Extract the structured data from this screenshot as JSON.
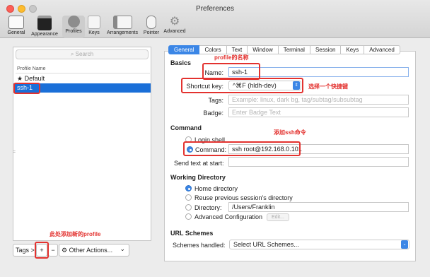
{
  "window": {
    "title": "Preferences"
  },
  "toolbar": [
    {
      "label": "General",
      "icon": "general-icon"
    },
    {
      "label": "Appearance",
      "icon": "appearance-icon"
    },
    {
      "label": "Profiles",
      "icon": "profiles-icon",
      "selected": true
    },
    {
      "label": "Keys",
      "icon": "keys-icon"
    },
    {
      "label": "Arrangements",
      "icon": "arrangements-icon"
    },
    {
      "label": "Pointer",
      "icon": "pointer-icon"
    },
    {
      "label": "Advanced",
      "icon": "gear-icon"
    }
  ],
  "profiles": {
    "search_placeholder": "Search",
    "column_header": "Profile Name",
    "items": [
      {
        "name": "★ Default"
      },
      {
        "name": "ssh-1",
        "selected": true
      }
    ],
    "tags_button": "Tags >",
    "add_button": "+",
    "remove_button": "−",
    "other_actions": "Other Actions...",
    "other_actions_chevron": "⌄"
  },
  "tabs": [
    "General",
    "Colors",
    "Text",
    "Window",
    "Terminal",
    "Session",
    "Keys",
    "Advanced"
  ],
  "basics": {
    "heading": "Basics",
    "name_label": "Name:",
    "name_value": "ssh-1",
    "shortcut_label": "Shortcut key:",
    "shortcut_value": "^⌘F (hldh-dev)",
    "tags_label": "Tags:",
    "tags_placeholder": "Example: linux, dark bg, tag/subtag/subsubtag",
    "badge_label": "Badge:",
    "badge_placeholder": "Enter Badge Text"
  },
  "command": {
    "heading": "Command",
    "login_shell": "Login shell",
    "command_label": "Command:",
    "command_value": "ssh root@192.168.0.101",
    "send_text_label": "Send text at start:"
  },
  "working_directory": {
    "heading": "Working Directory",
    "home": "Home directory",
    "reuse": "Reuse previous session's directory",
    "directory_label": "Directory:",
    "directory_value": "/Users/Franklin",
    "advanced": "Advanced Configuration",
    "edit_button": "Edit..."
  },
  "url_schemes": {
    "heading": "URL Schemes",
    "handled_label": "Schemes handled:",
    "select_value": "Select URL Schemes..."
  },
  "annotations": {
    "profile_name": "profile的名称",
    "shortcut": "选择一个快捷键",
    "add_ssh": "添加ssh命令",
    "add_profile": "此处添加新的profile"
  },
  "colors": {
    "accent": "#3b86e6",
    "annotation": "#e3322f",
    "selection": "#1a6fd8"
  }
}
